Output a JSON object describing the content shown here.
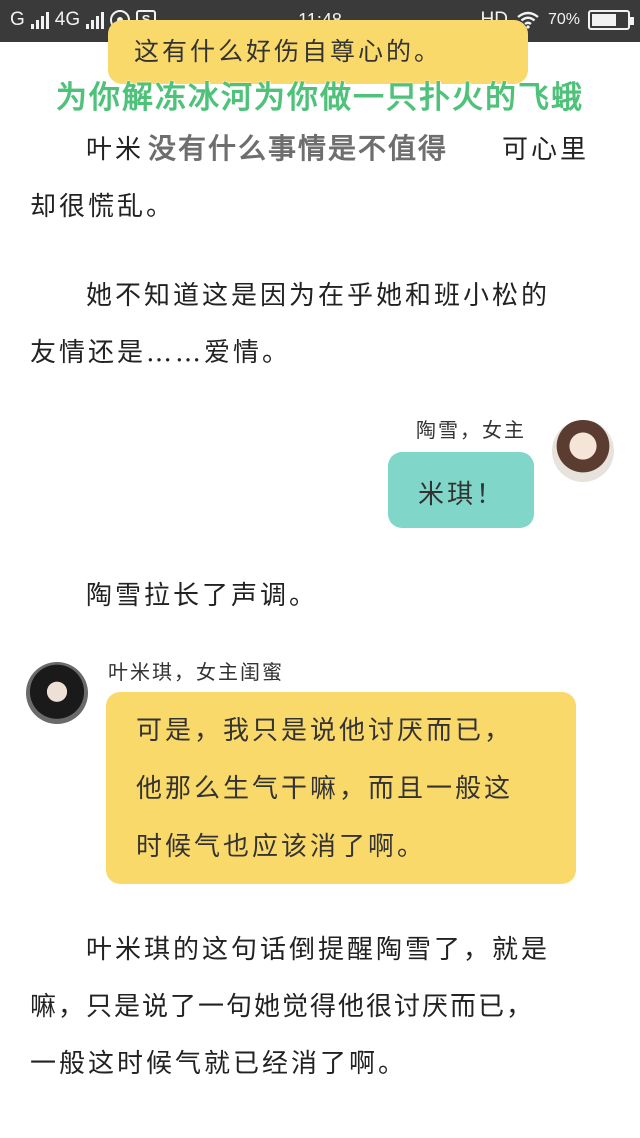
{
  "status_bar": {
    "carrier_label": "G",
    "network_label": "4G",
    "time": "11:48",
    "hd_label": "HD",
    "battery_percent": "70%",
    "battery_level": 0.7
  },
  "overlay": {
    "green_text": "为你解冻冰河为你做一只扑火的飞蛾",
    "dark_text": "没有什么事情是不值得"
  },
  "story": {
    "top_bubble_text": "这有什么好伤自尊心的。",
    "para1_line1_left": "叶米",
    "para1_line1_right": "可心里",
    "para1_line2": "却很慌乱。",
    "para2_line1": "她不知道这是因为在乎她和班小松的",
    "para2_line2": "友情还是……爱情。",
    "right_speaker": "陶雪，女主",
    "teal_bubble_text": "米琪！",
    "narration": "陶雪拉长了声调。",
    "left_speaker": "叶米琪，女主闺蜜",
    "yellow_line1": "可是，我只是说他讨厌而已，",
    "yellow_line2": "他那么生气干嘛，而且一般这",
    "yellow_line3": "时候气也应该消了啊。",
    "para3_line1": "叶米琪的这句话倒提醒陶雪了，就是",
    "para3_line2": "嘛，只是说了一句她觉得他很讨厌而已，",
    "para3_line3": "一般这时候气就已经消了啊。"
  },
  "colors": {
    "yellow_bubble": "#fad96b",
    "teal_bubble": "#7fd6c9",
    "overlay_green": "#4fc27a"
  }
}
